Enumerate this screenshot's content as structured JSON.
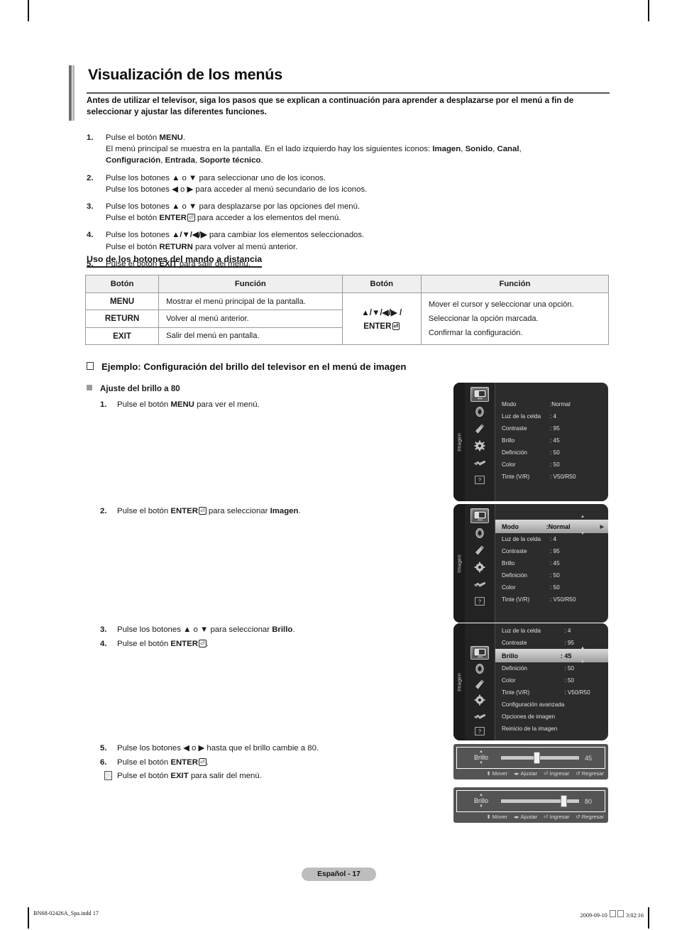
{
  "document": {
    "title": "Visualización de los menús",
    "intro": "Antes de utilizar el televisor, siga los pasos que se explican a continuación para aprender a desplazarse por el menú a fin de seleccionar y ajustar las diferentes funciones."
  },
  "steps": [
    {
      "num": "1.",
      "lines": [
        "Pulse el botón MENU.",
        "El menú principal se muestra en la pantalla. En el lado izquierdo hay los siguientes iconos: Imagen, Sonido, Canal, Configuración, Entrada, Soporte técnico."
      ]
    },
    {
      "num": "2.",
      "lines": [
        "Pulse los botones ▲ o ▼ para seleccionar uno de los iconos.",
        "Pulse los botones ◀ o ▶ para acceder al menú secundario de los iconos."
      ]
    },
    {
      "num": "3.",
      "lines": [
        "Pulse los botones ▲ o ▼ para desplazarse por las opciones del menú.",
        "Pulse el botón ENTER para acceder a los elementos del menú."
      ]
    },
    {
      "num": "4.",
      "lines": [
        "Pulse los botones ▲/▼/◀/▶ para cambiar los elementos seleccionados.",
        "Pulse el botón RETURN para volver al menú anterior."
      ]
    },
    {
      "num": "5.",
      "lines": [
        "Pulse el botón EXIT para salir del menú."
      ]
    }
  ],
  "remote_section": {
    "heading": "Uso de los botones del mando a distancia",
    "headers": [
      "Botón",
      "Función",
      "Botón",
      "Función"
    ],
    "rows": [
      {
        "button": "MENU",
        "function": "Mostrar el menú principal de la pantalla."
      },
      {
        "button": "RETURN",
        "function": "Volver al menú anterior."
      },
      {
        "button": "EXIT",
        "function": "Salir del menú en pantalla."
      }
    ],
    "right_button_line1": "▲/▼/◀/▶ /",
    "right_button_line2": "ENTER",
    "right_functions": [
      "Mover el cursor y seleccionar una opción.",
      "Seleccionar la opción marcada.",
      "Confirmar la configuración."
    ]
  },
  "example": {
    "heading": "Ejemplo: Configuración del brillo del televisor en el menú de imagen",
    "subheading": "Ajuste del brillo a 80",
    "steps": [
      {
        "num": "1.",
        "text_pre": "Pulse el botón ",
        "bold": "MENU",
        "text_post": " para ver el menú."
      },
      {
        "num": "2.",
        "text_pre": "Pulse el botón ",
        "bold": "ENTER",
        "text_post": " para seleccionar ",
        "bold2": "Imagen",
        "text_end": "."
      },
      {
        "num": "3.",
        "text_pre": "Pulse los botones ▲ o ▼ para seleccionar ",
        "bold": "Brillo",
        "text_post": "."
      },
      {
        "num": "4.",
        "text_pre": "Pulse el botón ",
        "bold": "ENTER",
        "text_post": "."
      },
      {
        "num": "5.",
        "text_pre": "Pulse los botones ◀ o ▶ hasta que el brillo cambie a 80.",
        "bold": "",
        "text_post": ""
      },
      {
        "num": "6.",
        "text_pre": "Pulse el botón ",
        "bold": "ENTER",
        "text_post": "."
      }
    ],
    "note": {
      "text_pre": "Pulse el botón ",
      "bold": "EXIT",
      "text_post": " para salir del menú."
    }
  },
  "osd": {
    "rail_label": "Imagen",
    "icons": [
      "picture-icon",
      "sound-icon",
      "channel-icon",
      "setup-icon",
      "input-icon",
      "support-icon"
    ],
    "panel1": {
      "rows": [
        {
          "label": "Modo",
          "value": ":Normal",
          "selected": false
        },
        {
          "label": "Luz de la celda",
          "value": ": 4",
          "selected": false
        },
        {
          "label": "Contraste",
          "value": ": 95",
          "selected": false
        },
        {
          "label": "Brillo",
          "value": ": 45",
          "selected": false
        },
        {
          "label": "Definición",
          "value": ": 50",
          "selected": false
        },
        {
          "label": "Color",
          "value": ": 50",
          "selected": false
        },
        {
          "label": "Tinte (V/R)",
          "value": ": V50/R50",
          "selected": false
        }
      ]
    },
    "panel2": {
      "rows": [
        {
          "label": "Modo",
          "value": ":Normal",
          "selected": true
        },
        {
          "label": "Luz de la celda",
          "value": ": 4",
          "selected": false
        },
        {
          "label": "Contraste",
          "value": ": 95",
          "selected": false
        },
        {
          "label": "Brillo",
          "value": ": 45",
          "selected": false
        },
        {
          "label": "Definición",
          "value": ": 50",
          "selected": false
        },
        {
          "label": "Color",
          "value": ": 50",
          "selected": false
        },
        {
          "label": "Tinte (V/R)",
          "value": ": V50/R50",
          "selected": false
        }
      ]
    },
    "panel3": {
      "rows": [
        {
          "label": "Luz de la celda",
          "value": ": 4",
          "selected": false
        },
        {
          "label": "Contraste",
          "value": ": 95",
          "selected": false
        },
        {
          "label": "Brillo",
          "value": ": 45",
          "selected": true
        },
        {
          "label": "Definición",
          "value": ": 50",
          "selected": false
        },
        {
          "label": "Color",
          "value": ": 50",
          "selected": false
        },
        {
          "label": "Tinte (V/R)",
          "value": ": V50/R50",
          "selected": false
        },
        {
          "label": "Configuración avanzada",
          "value": "",
          "selected": false
        },
        {
          "label": "Opciones de imagen",
          "value": "",
          "selected": false
        },
        {
          "label": "Reinicio de la imagen",
          "value": "",
          "selected": false
        }
      ]
    }
  },
  "sliders": [
    {
      "name": "Brillo",
      "value": "45",
      "percent": 45
    },
    {
      "name": "Brillo",
      "value": "80",
      "percent": 80
    }
  ],
  "slider_footer": [
    {
      "glyph": "◆",
      "label": "Mover"
    },
    {
      "glyph": "◀▶",
      "label": "Ajustar"
    },
    {
      "glyph": "⏎",
      "label": "Ingresar"
    },
    {
      "glyph": "↺",
      "label": "Regresar"
    }
  ],
  "footer": {
    "page_badge": "Español - 17",
    "file_info": "BN68-02426A_Spa.indd   17",
    "date": "2009-09-10",
    "time": "3:02:16"
  }
}
